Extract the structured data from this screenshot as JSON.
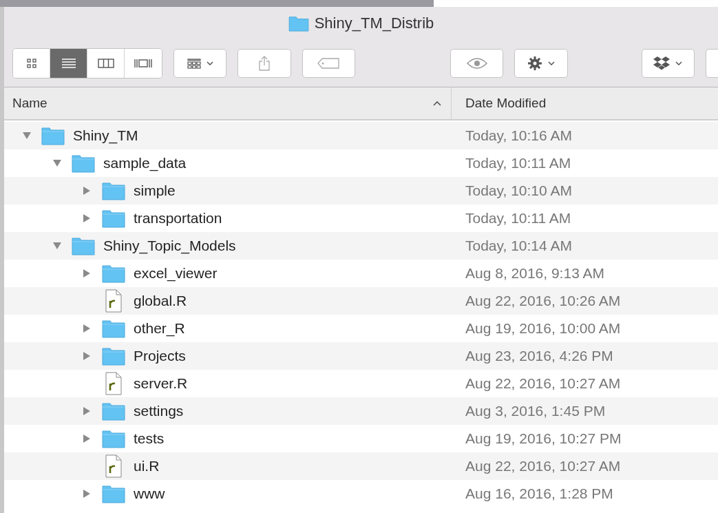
{
  "window": {
    "title": "Shiny_TM_Distrib"
  },
  "toolbar": {
    "view_modes": [
      {
        "selected": false
      },
      {
        "selected": true
      },
      {
        "selected": false
      },
      {
        "selected": false
      }
    ]
  },
  "columns": [
    {
      "label": "Name",
      "sorted": true
    },
    {
      "label": "Date Modified",
      "sorted": false
    }
  ],
  "tree": [
    {
      "kind": "folder",
      "name": "Shiny_TM",
      "date": "Today, 10:16 AM",
      "expanded": true,
      "children": [
        {
          "kind": "folder",
          "name": "sample_data",
          "date": "Today, 10:11 AM",
          "expanded": true,
          "children": [
            {
              "kind": "folder",
              "name": "simple",
              "date": "Today, 10:10 AM",
              "expanded": false
            },
            {
              "kind": "folder",
              "name": "transportation",
              "date": "Today, 10:11 AM",
              "expanded": false
            }
          ]
        },
        {
          "kind": "folder",
          "name": "Shiny_Topic_Models",
          "date": "Today, 10:14 AM",
          "expanded": true,
          "children": [
            {
              "kind": "folder",
              "name": "excel_viewer",
              "date": "Aug 8, 2016, 9:13 AM",
              "expanded": false
            },
            {
              "kind": "file",
              "name": "global.R",
              "date": "Aug 22, 2016, 10:26 AM"
            },
            {
              "kind": "folder",
              "name": "other_R",
              "date": "Aug 19, 2016, 10:00 AM",
              "expanded": false
            },
            {
              "kind": "folder",
              "name": "Projects",
              "date": "Aug 23, 2016, 4:26 PM",
              "expanded": false
            },
            {
              "kind": "file",
              "name": "server.R",
              "date": "Aug 22, 2016, 10:27 AM"
            },
            {
              "kind": "folder",
              "name": "settings",
              "date": "Aug 3, 2016, 1:45 PM",
              "expanded": false
            },
            {
              "kind": "folder",
              "name": "tests",
              "date": "Aug 19, 2016, 10:27 PM",
              "expanded": false
            },
            {
              "kind": "file",
              "name": "ui.R",
              "date": "Aug 22, 2016, 10:27 AM"
            },
            {
              "kind": "folder",
              "name": "www",
              "date": "Aug 16, 2016, 1:28 PM",
              "expanded": false
            }
          ]
        }
      ]
    }
  ]
}
